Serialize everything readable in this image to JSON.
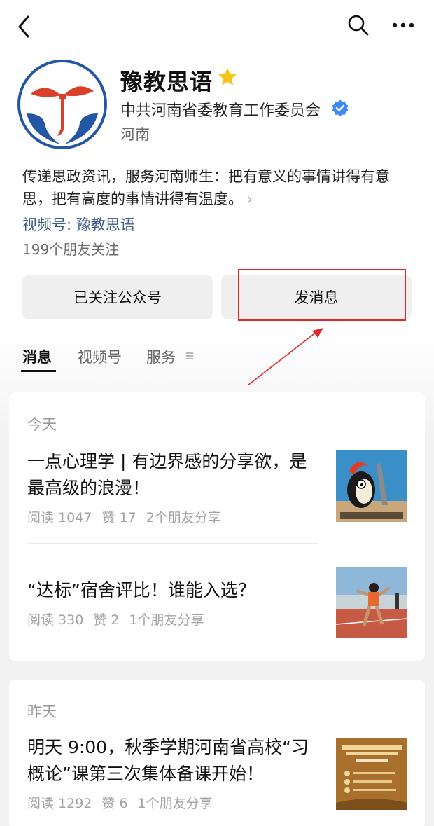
{
  "header": {
    "back_icon": "chevron-left-icon",
    "search_icon": "search-icon",
    "more_icon": "more-horizontal-icon"
  },
  "profile": {
    "name": "豫教思语",
    "star_icon": "star-icon",
    "organization": "中共河南省委教育工作委员会",
    "verify_icon": "verified-badge-icon",
    "region": "河南",
    "description": "传递思政资讯，服务河南师生：把有意义的事情讲得有意思，把有高度的事情讲得有温度。",
    "description_more": "›",
    "channel": "视频号: 豫教思语",
    "friends_follow": "199个朋友关注",
    "accent_color": "#3c5a8a",
    "star_color": "#f5c518",
    "verify_color": "#3d8bf2"
  },
  "actions": {
    "followed_label": "已关注公众号",
    "message_label": "发消息",
    "highlight_color": "#e0282a"
  },
  "tabs": [
    {
      "label": "消息",
      "active": true
    },
    {
      "label": "视频号",
      "active": false
    },
    {
      "label": "服务",
      "active": false
    }
  ],
  "tab_menu_icon": "menu-lines-icon",
  "feed": [
    {
      "day": "今天",
      "articles": [
        {
          "title": "一点心理学 | 有边界感的分享欲，是最高级的浪漫！",
          "reads": "阅读 1047",
          "likes": "赞 17",
          "shares": "2个朋友分享",
          "thumbnail": "cartoon-woodpecker-thumbnail"
        },
        {
          "title": "“达标”宿舍评比！谁能入选？",
          "reads": "阅读 330",
          "likes": "赞 2",
          "shares": "1个朋友分享",
          "thumbnail": "sprinter-track-thumbnail"
        }
      ]
    },
    {
      "day": "昨天",
      "articles": [
        {
          "title": "明天 9:00，秋季学期河南省高校“习概论”课第三次集体备课开始！",
          "reads": "阅读 1292",
          "likes": "赞 6",
          "shares": "1个朋友分享",
          "thumbnail": "gold-poster-thumbnail"
        }
      ]
    }
  ]
}
